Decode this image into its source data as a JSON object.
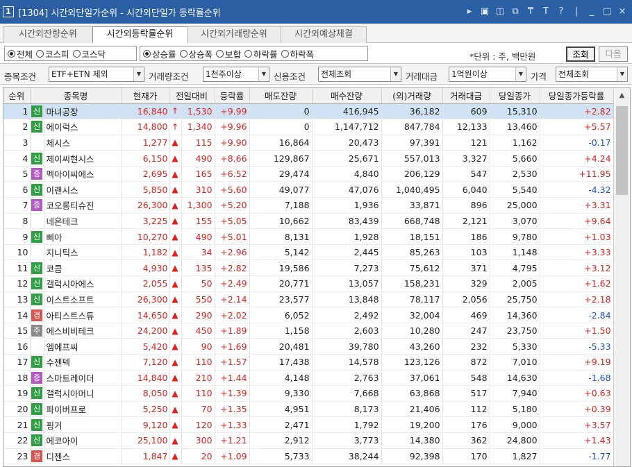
{
  "window": {
    "number": "1",
    "title": "[1304] 시간외단일가순위 - 시간외단일가 등락률순위",
    "icons": [
      "play-icon",
      "screen-icon",
      "window-icon",
      "link-icon",
      "pin-icon",
      "font-icon",
      "help-icon",
      "minimize-icon",
      "maximize-icon",
      "close-icon"
    ]
  },
  "tabs": [
    {
      "label": "시간외잔량순위",
      "active": false
    },
    {
      "label": "시간외등락률순위",
      "active": true
    },
    {
      "label": "시간외거래량순위",
      "active": false
    },
    {
      "label": "시간외예상체결",
      "active": false
    }
  ],
  "market_group": [
    {
      "label": "전체",
      "selected": true
    },
    {
      "label": "코스피",
      "selected": false
    },
    {
      "label": "코스닥",
      "selected": false
    }
  ],
  "sort_group": [
    {
      "label": "상승률",
      "selected": true
    },
    {
      "label": "상승폭",
      "selected": false
    },
    {
      "label": "보합",
      "selected": false
    },
    {
      "label": "하락률",
      "selected": false
    },
    {
      "label": "하락폭",
      "selected": false
    }
  ],
  "unit_label": "*단위 : 주, 백만원",
  "buttons": {
    "query": "조회",
    "next": "다음"
  },
  "filters": {
    "item_condition": {
      "label": "종목조건",
      "value": "ETF+ETN 제외"
    },
    "volume_condition": {
      "label": "거래량조건",
      "value": "1천주이상"
    },
    "credit_condition": {
      "label": "신용조건",
      "value": "전체조회"
    },
    "trade_amount": {
      "label": "거래대금",
      "value": "1억원이상"
    },
    "price": {
      "label": "가격",
      "value": "전체조회"
    }
  },
  "badge_colors": {
    "신": "#2f9e44",
    "증": "#b05ac0",
    "경": "#d9534f",
    "주": "#8a8a8a"
  },
  "table": {
    "columns": [
      "순위",
      "종목명",
      "현재가",
      "전일대비",
      "등락률",
      "매도잔량",
      "매수잔량",
      "(외)거래량",
      "거래대금",
      "당일종가",
      "당일종가등락률"
    ],
    "rows": [
      {
        "rank": "1",
        "badge": "신",
        "name": "마녀공장",
        "price": "16,840",
        "arrow": "↑",
        "change": "1,530",
        "rate": "+9.99",
        "sell": "0",
        "buy": "416,945",
        "volume": "36,182",
        "amount": "609",
        "close": "15,310",
        "close_rate": "+2.82",
        "dir": "up"
      },
      {
        "rank": "2",
        "badge": "신",
        "name": "에이럭스",
        "price": "14,800",
        "arrow": "↑",
        "change": "1,340",
        "rate": "+9.96",
        "sell": "0",
        "buy": "1,147,712",
        "volume": "847,784",
        "amount": "12,133",
        "close": "13,460",
        "close_rate": "+5.57",
        "dir": "up"
      },
      {
        "rank": "3",
        "badge": "",
        "name": "체시스",
        "price": "1,277",
        "arrow": "▲",
        "change": "115",
        "rate": "+9.90",
        "sell": "16,864",
        "buy": "20,473",
        "volume": "97,391",
        "amount": "121",
        "close": "1,162",
        "close_rate": "-0.17",
        "dir": "down"
      },
      {
        "rank": "4",
        "badge": "신",
        "name": "제이씨현시스",
        "price": "6,150",
        "arrow": "▲",
        "change": "490",
        "rate": "+8.66",
        "sell": "129,867",
        "buy": "25,671",
        "volume": "557,013",
        "amount": "3,327",
        "close": "5,660",
        "close_rate": "+4.24",
        "dir": "up"
      },
      {
        "rank": "5",
        "badge": "증",
        "name": "멕아이씨에스",
        "price": "2,695",
        "arrow": "▲",
        "change": "165",
        "rate": "+6.52",
        "sell": "29,474",
        "buy": "4,840",
        "volume": "206,129",
        "amount": "547",
        "close": "2,530",
        "close_rate": "+11.95",
        "dir": "up"
      },
      {
        "rank": "6",
        "badge": "신",
        "name": "이랜시스",
        "price": "5,850",
        "arrow": "▲",
        "change": "310",
        "rate": "+5.60",
        "sell": "49,077",
        "buy": "47,076",
        "volume": "1,040,495",
        "amount": "6,040",
        "close": "5,540",
        "close_rate": "-4.32",
        "dir": "down"
      },
      {
        "rank": "7",
        "badge": "증",
        "name": "코오롱티슈진",
        "price": "26,300",
        "arrow": "▲",
        "change": "1,300",
        "rate": "+5.20",
        "sell": "7,188",
        "buy": "1,936",
        "volume": "33,871",
        "amount": "896",
        "close": "25,000",
        "close_rate": "+3.31",
        "dir": "up"
      },
      {
        "rank": "8",
        "badge": "",
        "name": "네온테크",
        "price": "3,225",
        "arrow": "▲",
        "change": "155",
        "rate": "+5.05",
        "sell": "10,662",
        "buy": "83,439",
        "volume": "668,748",
        "amount": "2,121",
        "close": "3,070",
        "close_rate": "+9.64",
        "dir": "up"
      },
      {
        "rank": "9",
        "badge": "신",
        "name": "삐아",
        "price": "10,270",
        "arrow": "▲",
        "change": "490",
        "rate": "+5.01",
        "sell": "8,131",
        "buy": "1,928",
        "volume": "18,151",
        "amount": "186",
        "close": "9,780",
        "close_rate": "+1.03",
        "dir": "up"
      },
      {
        "rank": "10",
        "badge": "",
        "name": "지니틱스",
        "price": "1,182",
        "arrow": "▲",
        "change": "34",
        "rate": "+2.96",
        "sell": "5,142",
        "buy": "2,445",
        "volume": "85,263",
        "amount": "103",
        "close": "1,148",
        "close_rate": "+3.33",
        "dir": "up"
      },
      {
        "rank": "11",
        "badge": "신",
        "name": "코콤",
        "price": "4,930",
        "arrow": "▲",
        "change": "135",
        "rate": "+2.82",
        "sell": "19,586",
        "buy": "7,273",
        "volume": "75,612",
        "amount": "371",
        "close": "4,795",
        "close_rate": "+3.12",
        "dir": "up"
      },
      {
        "rank": "12",
        "badge": "신",
        "name": "갤럭시아에스",
        "price": "2,055",
        "arrow": "▲",
        "change": "50",
        "rate": "+2.49",
        "sell": "20,771",
        "buy": "13,057",
        "volume": "158,231",
        "amount": "329",
        "close": "2,005",
        "close_rate": "+1.62",
        "dir": "up"
      },
      {
        "rank": "13",
        "badge": "신",
        "name": "이스트소프트",
        "price": "26,300",
        "arrow": "▲",
        "change": "550",
        "rate": "+2.14",
        "sell": "23,577",
        "buy": "13,848",
        "volume": "78,117",
        "amount": "2,056",
        "close": "25,750",
        "close_rate": "+2.18",
        "dir": "up"
      },
      {
        "rank": "14",
        "badge": "경",
        "name": "아티스트스튜",
        "price": "14,650",
        "arrow": "▲",
        "change": "290",
        "rate": "+2.02",
        "sell": "6,052",
        "buy": "2,492",
        "volume": "32,004",
        "amount": "469",
        "close": "14,360",
        "close_rate": "-2.84",
        "dir": "down"
      },
      {
        "rank": "15",
        "badge": "주",
        "name": "에스비비테크",
        "price": "24,200",
        "arrow": "▲",
        "change": "450",
        "rate": "+1.89",
        "sell": "1,158",
        "buy": "2,603",
        "volume": "10,280",
        "amount": "247",
        "close": "23,750",
        "close_rate": "+1.50",
        "dir": "up"
      },
      {
        "rank": "16",
        "badge": "",
        "name": "엠에프씨",
        "price": "5,420",
        "arrow": "▲",
        "change": "90",
        "rate": "+1.69",
        "sell": "20,481",
        "buy": "39,780",
        "volume": "43,260",
        "amount": "232",
        "close": "5,330",
        "close_rate": "-5.33",
        "dir": "down"
      },
      {
        "rank": "17",
        "badge": "신",
        "name": "수젠텍",
        "price": "7,120",
        "arrow": "▲",
        "change": "110",
        "rate": "+1.57",
        "sell": "17,438",
        "buy": "14,578",
        "volume": "123,126",
        "amount": "872",
        "close": "7,010",
        "close_rate": "+9.19",
        "dir": "up"
      },
      {
        "rank": "18",
        "badge": "증",
        "name": "스마트레이더",
        "price": "14,840",
        "arrow": "▲",
        "change": "210",
        "rate": "+1.44",
        "sell": "4,148",
        "buy": "2,763",
        "volume": "37,061",
        "amount": "548",
        "close": "14,630",
        "close_rate": "-1.68",
        "dir": "down"
      },
      {
        "rank": "19",
        "badge": "신",
        "name": "갤럭시아머니",
        "price": "8,050",
        "arrow": "▲",
        "change": "110",
        "rate": "+1.39",
        "sell": "9,330",
        "buy": "7,668",
        "volume": "63,868",
        "amount": "517",
        "close": "7,940",
        "close_rate": "+0.63",
        "dir": "up"
      },
      {
        "rank": "20",
        "badge": "신",
        "name": "파이버프로",
        "price": "5,250",
        "arrow": "▲",
        "change": "70",
        "rate": "+1.35",
        "sell": "4,951",
        "buy": "8,173",
        "volume": "21,406",
        "amount": "112",
        "close": "5,180",
        "close_rate": "+0.39",
        "dir": "up"
      },
      {
        "rank": "21",
        "badge": "신",
        "name": "핑거",
        "price": "9,120",
        "arrow": "▲",
        "change": "120",
        "rate": "+1.33",
        "sell": "2,471",
        "buy": "1,792",
        "volume": "19,200",
        "amount": "176",
        "close": "9,000",
        "close_rate": "+3.57",
        "dir": "up"
      },
      {
        "rank": "22",
        "badge": "신",
        "name": "에코아이",
        "price": "25,100",
        "arrow": "▲",
        "change": "300",
        "rate": "+1.21",
        "sell": "2,912",
        "buy": "3,773",
        "volume": "14,380",
        "amount": "362",
        "close": "24,800",
        "close_rate": "+1.43",
        "dir": "up"
      },
      {
        "rank": "23",
        "badge": "경",
        "name": "디젠스",
        "price": "1,847",
        "arrow": "▲",
        "change": "20",
        "rate": "+1.09",
        "sell": "5,733",
        "buy": "38,244",
        "volume": "92,398",
        "amount": "170",
        "close": "1,827",
        "close_rate": "-1.77",
        "dir": "down"
      }
    ]
  }
}
